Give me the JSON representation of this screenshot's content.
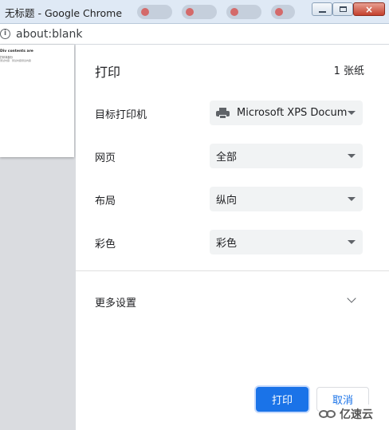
{
  "window": {
    "title": "无标题 - Google Chrome",
    "controls": {
      "minimize": "minimize",
      "maximize": "maximize",
      "close": "×"
    }
  },
  "address_bar": {
    "url": "about:blank",
    "info_icon": "i"
  },
  "preview": {
    "heading": "Div contents are",
    "line1": "打印本部分",
    "line2": "测试内容 · 测试内容测试内容"
  },
  "print_panel": {
    "title": "打印",
    "sheet_count": "1 张纸",
    "settings": [
      {
        "label": "目标打印机",
        "value": "Microsoft XPS Docum"
      },
      {
        "label": "网页",
        "value": "全部"
      },
      {
        "label": "布局",
        "value": "纵向"
      },
      {
        "label": "彩色",
        "value": "彩色"
      }
    ],
    "more_settings": "更多设置",
    "print_button": "打印",
    "cancel_button": "取消"
  },
  "watermark": {
    "text": "亿速云"
  },
  "colors": {
    "accent": "#1a73e8",
    "select_bg": "#f1f3f4",
    "preview_bg": "#dadce0"
  }
}
